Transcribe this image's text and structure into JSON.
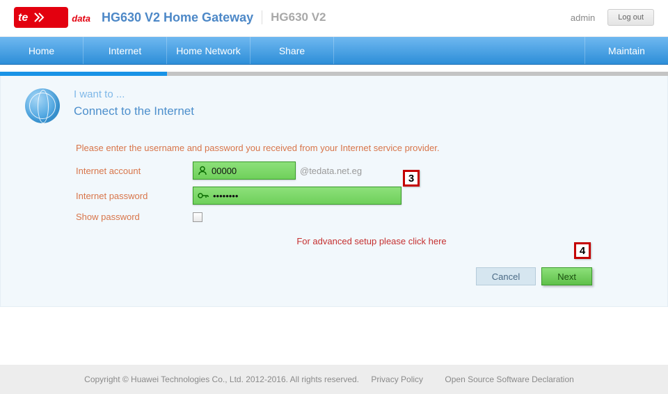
{
  "header": {
    "logo_text": "data",
    "product_title": "HG630 V2 Home Gateway",
    "model": "HG630 V2",
    "user": "admin",
    "logout_label": "Log out"
  },
  "nav": {
    "items": [
      "Home",
      "Internet",
      "Home Network",
      "Share"
    ],
    "maintain": "Maintain"
  },
  "wizard": {
    "want_to": "I want to ...",
    "subtitle": "Connect to the Internet",
    "instruction": "Please enter the username and password you received from your Internet service provider.",
    "account_label": "Internet account",
    "account_value": "00000",
    "account_domain": "@tedata.net.eg",
    "password_label": "Internet password",
    "password_value": "••••••••",
    "show_password_label": "Show password",
    "advanced_link": "For advanced setup please click here",
    "cancel_label": "Cancel",
    "next_label": "Next",
    "callouts": {
      "step3": "3",
      "step4": "4"
    }
  },
  "footer": {
    "copyright": "Copyright © Huawei Technologies Co., Ltd. 2012-2016. All rights reserved.",
    "privacy": "Privacy Policy",
    "oss": "Open Source Software Declaration"
  }
}
